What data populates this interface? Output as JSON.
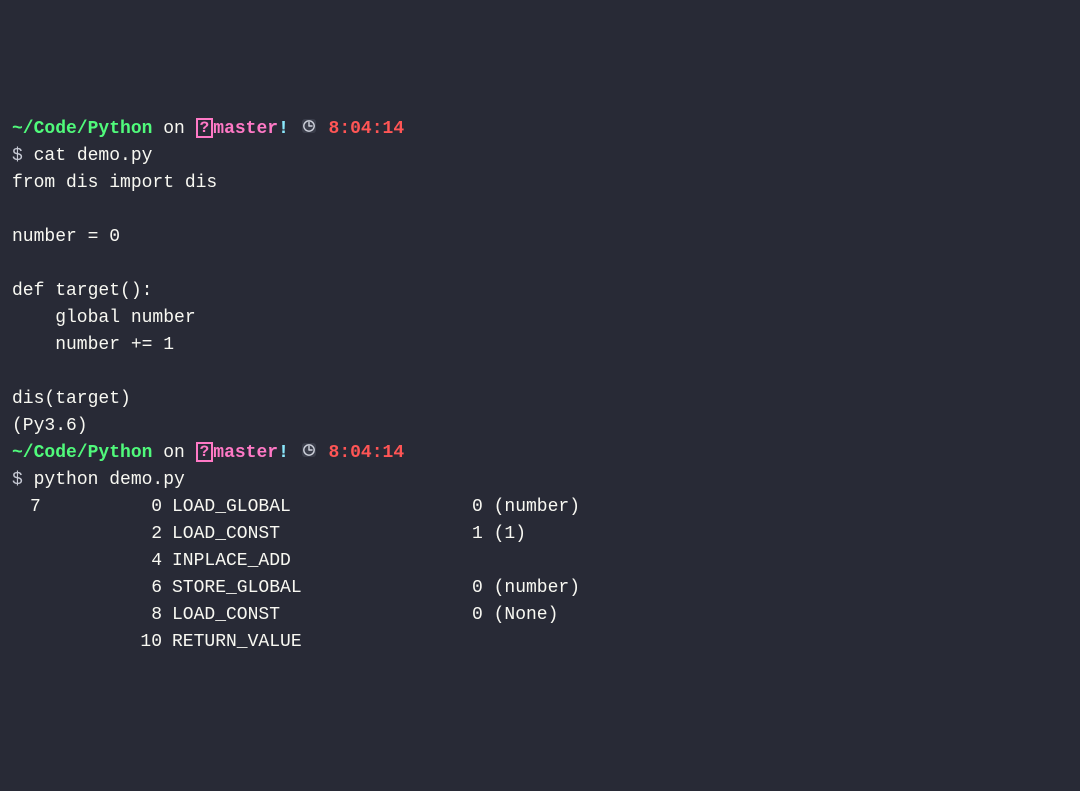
{
  "prompt1": {
    "path": "~/Code/Python",
    "on": " on ",
    "branch_question": "?",
    "branch": "master",
    "bang": "!",
    "time": "8:04:14",
    "dollar": "$ ",
    "command": "cat demo.py"
  },
  "source": {
    "lines": [
      "from dis import dis",
      "",
      "number = 0",
      "",
      "def target():",
      "    global number",
      "    number += 1",
      "",
      "dis(target)",
      "(Py3.6)"
    ]
  },
  "prompt2": {
    "path": "~/Code/Python",
    "on": " on ",
    "branch_question": "?",
    "branch": "master",
    "bang": "!",
    "time": "8:04:14",
    "dollar": "$ ",
    "command": "python demo.py"
  },
  "dis_output": {
    "rows": [
      {
        "lineno": "7",
        "offset": "0",
        "opname": "LOAD_GLOBAL",
        "arg": "0 (number)"
      },
      {
        "lineno": "",
        "offset": "2",
        "opname": "LOAD_CONST",
        "arg": "1 (1)"
      },
      {
        "lineno": "",
        "offset": "4",
        "opname": "INPLACE_ADD",
        "arg": ""
      },
      {
        "lineno": "",
        "offset": "6",
        "opname": "STORE_GLOBAL",
        "arg": "0 (number)"
      },
      {
        "lineno": "",
        "offset": "8",
        "opname": "LOAD_CONST",
        "arg": "0 (None)"
      },
      {
        "lineno": "",
        "offset": "10",
        "opname": "RETURN_VALUE",
        "arg": ""
      }
    ]
  }
}
